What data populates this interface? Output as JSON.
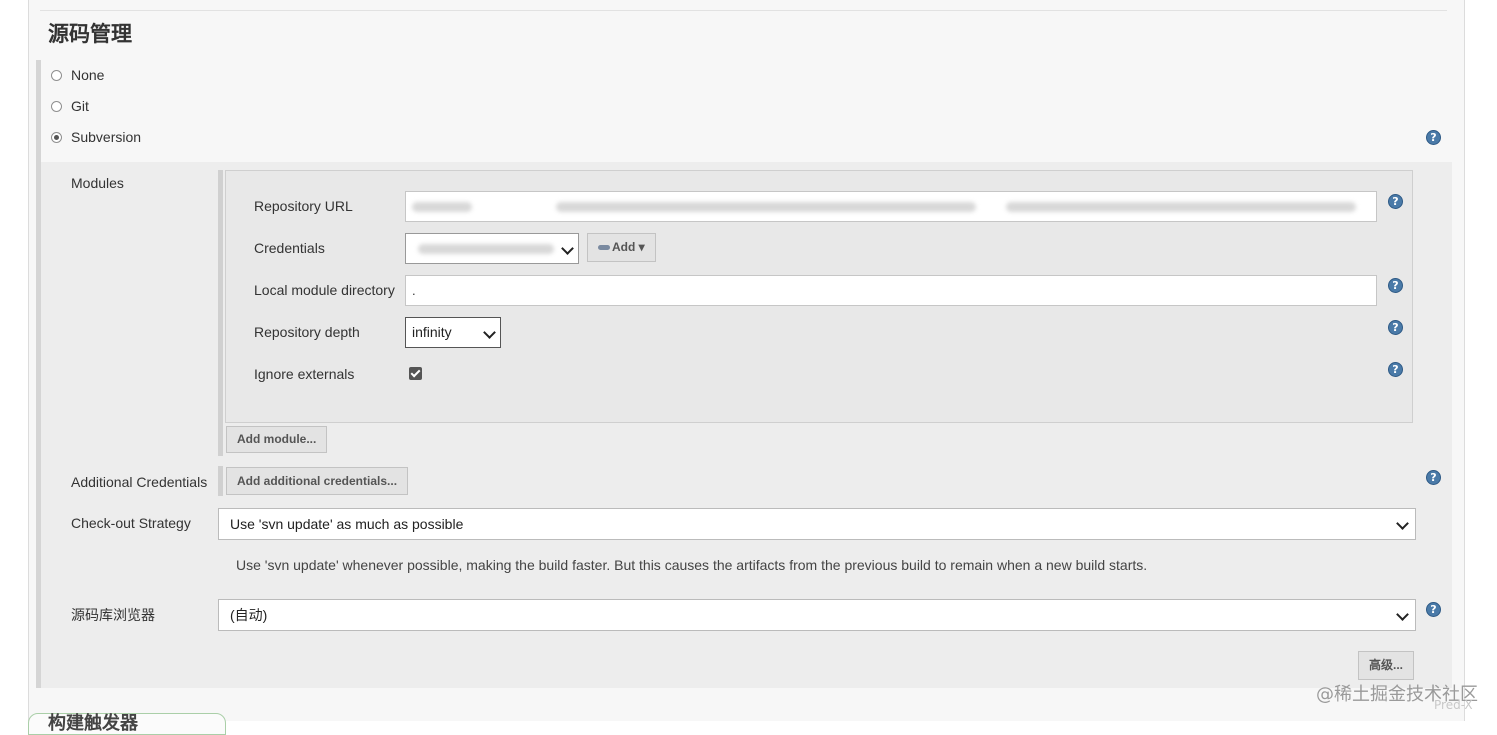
{
  "section": {
    "title": "源码管理"
  },
  "scm_options": [
    {
      "label": "None",
      "selected": false
    },
    {
      "label": "Git",
      "selected": false
    },
    {
      "label": "Subversion",
      "selected": true
    }
  ],
  "modules": {
    "label": "Modules",
    "repository_url": {
      "label": "Repository URL",
      "value": ""
    },
    "credentials": {
      "label": "Credentials",
      "value": "",
      "add_label": "Add"
    },
    "local_module_directory": {
      "label": "Local module directory",
      "value": "."
    },
    "repository_depth": {
      "label": "Repository depth",
      "value": "infinity"
    },
    "ignore_externals": {
      "label": "Ignore externals",
      "checked": true
    },
    "add_module_label": "Add module..."
  },
  "additional_credentials": {
    "label": "Additional Credentials",
    "button_label": "Add additional credentials..."
  },
  "checkout_strategy": {
    "label": "Check-out Strategy",
    "value": "Use 'svn update' as much as possible",
    "description": "Use 'svn update' whenever possible, making the build faster. But this causes the artifacts from the previous build to remain when a new build starts."
  },
  "repo_browser": {
    "label": "源码库浏览器",
    "value": "(自动)"
  },
  "advanced_label": "高级...",
  "help_glyph": "?",
  "next_section_title": "构建触发器",
  "watermark": {
    "site": "@稀土掘金技术社区",
    "author": "Pred-X"
  },
  "colors": {
    "help": "#4a7aa8",
    "panel": "#f7f7f7",
    "block": "#ededed"
  }
}
